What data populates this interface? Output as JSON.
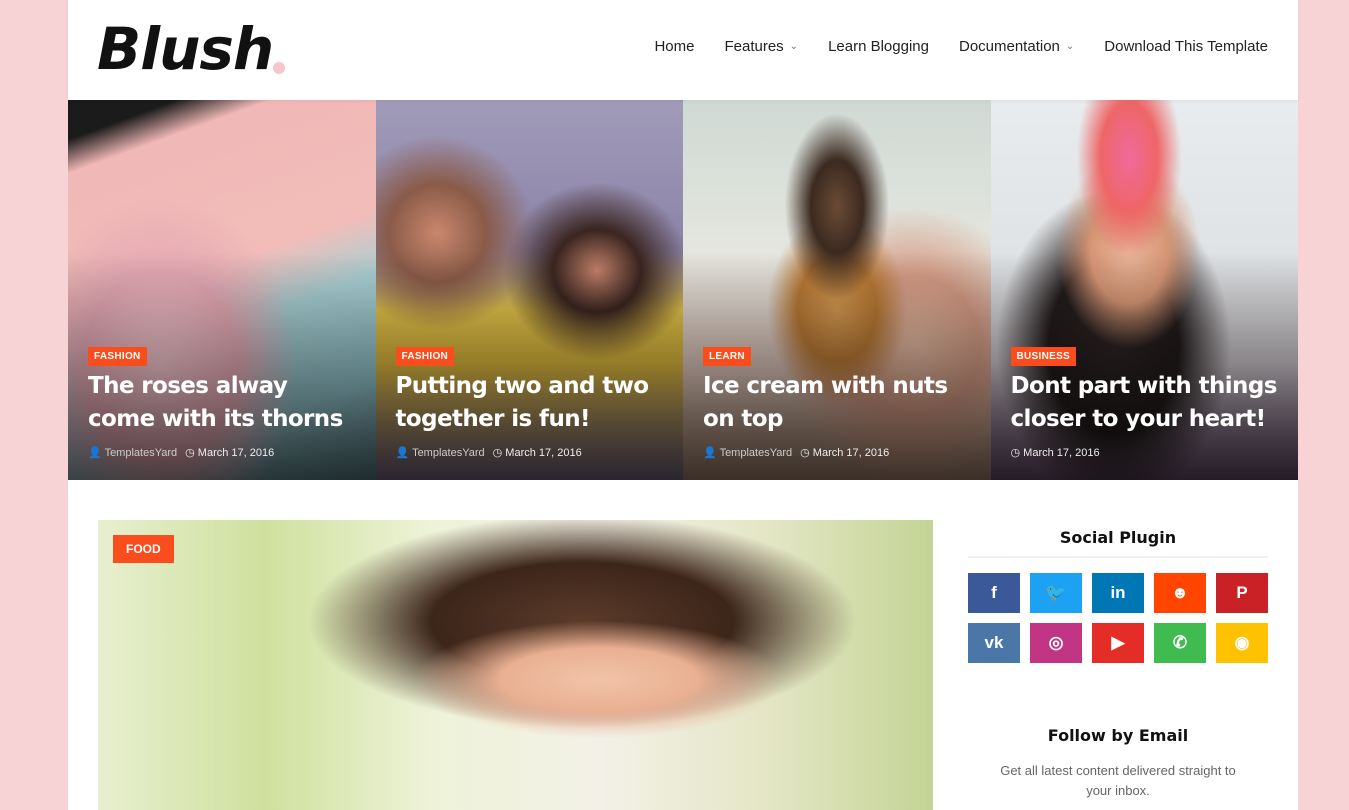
{
  "site": {
    "logo": "Blush"
  },
  "nav": [
    {
      "label": "Home",
      "dropdown": false
    },
    {
      "label": "Features",
      "dropdown": true
    },
    {
      "label": "Learn Blogging",
      "dropdown": false
    },
    {
      "label": "Documentation",
      "dropdown": true
    },
    {
      "label": "Download This Template",
      "dropdown": false
    }
  ],
  "featured": [
    {
      "category": "FASHION",
      "title": "The roses alway come with its thorns",
      "author": "TemplatesYard",
      "date": "March 17, 2016"
    },
    {
      "category": "FASHION",
      "title": "Putting two and two together is fun!",
      "author": "TemplatesYard",
      "date": "March 17, 2016"
    },
    {
      "category": "LEARN",
      "title": "Ice cream with nuts on top",
      "author": "TemplatesYard",
      "date": "March 17, 2016"
    },
    {
      "category": "BUSINESS",
      "title": "Dont part with things closer to your heart!",
      "author": "",
      "date": "March 17, 2016"
    }
  ],
  "main_post": {
    "category": "FOOD"
  },
  "sidebar": {
    "social_title": "Social Plugin",
    "social": [
      {
        "name": "facebook",
        "glyph": "f",
        "color": "#3b5998"
      },
      {
        "name": "twitter",
        "glyph": "🐦",
        "color": "#1da1f2"
      },
      {
        "name": "linkedin",
        "glyph": "in",
        "color": "#0077b5"
      },
      {
        "name": "reddit",
        "glyph": "☻",
        "color": "#ff4500"
      },
      {
        "name": "pinterest",
        "glyph": "P",
        "color": "#ca2127"
      },
      {
        "name": "vk",
        "glyph": "vk",
        "color": "#4a76a8"
      },
      {
        "name": "instagram",
        "glyph": "◎",
        "color": "#c13584"
      },
      {
        "name": "youtube",
        "glyph": "▶",
        "color": "#e52d27"
      },
      {
        "name": "whatsapp",
        "glyph": "✆",
        "color": "#3fbb50"
      },
      {
        "name": "rss",
        "glyph": "◉",
        "color": "#ffc200"
      }
    ],
    "email_title": "Follow by Email",
    "email_desc": "Get all latest content delivered straight to your inbox."
  },
  "colors": {
    "accent": "#fa4d1d",
    "background": "#f7d3d6"
  }
}
